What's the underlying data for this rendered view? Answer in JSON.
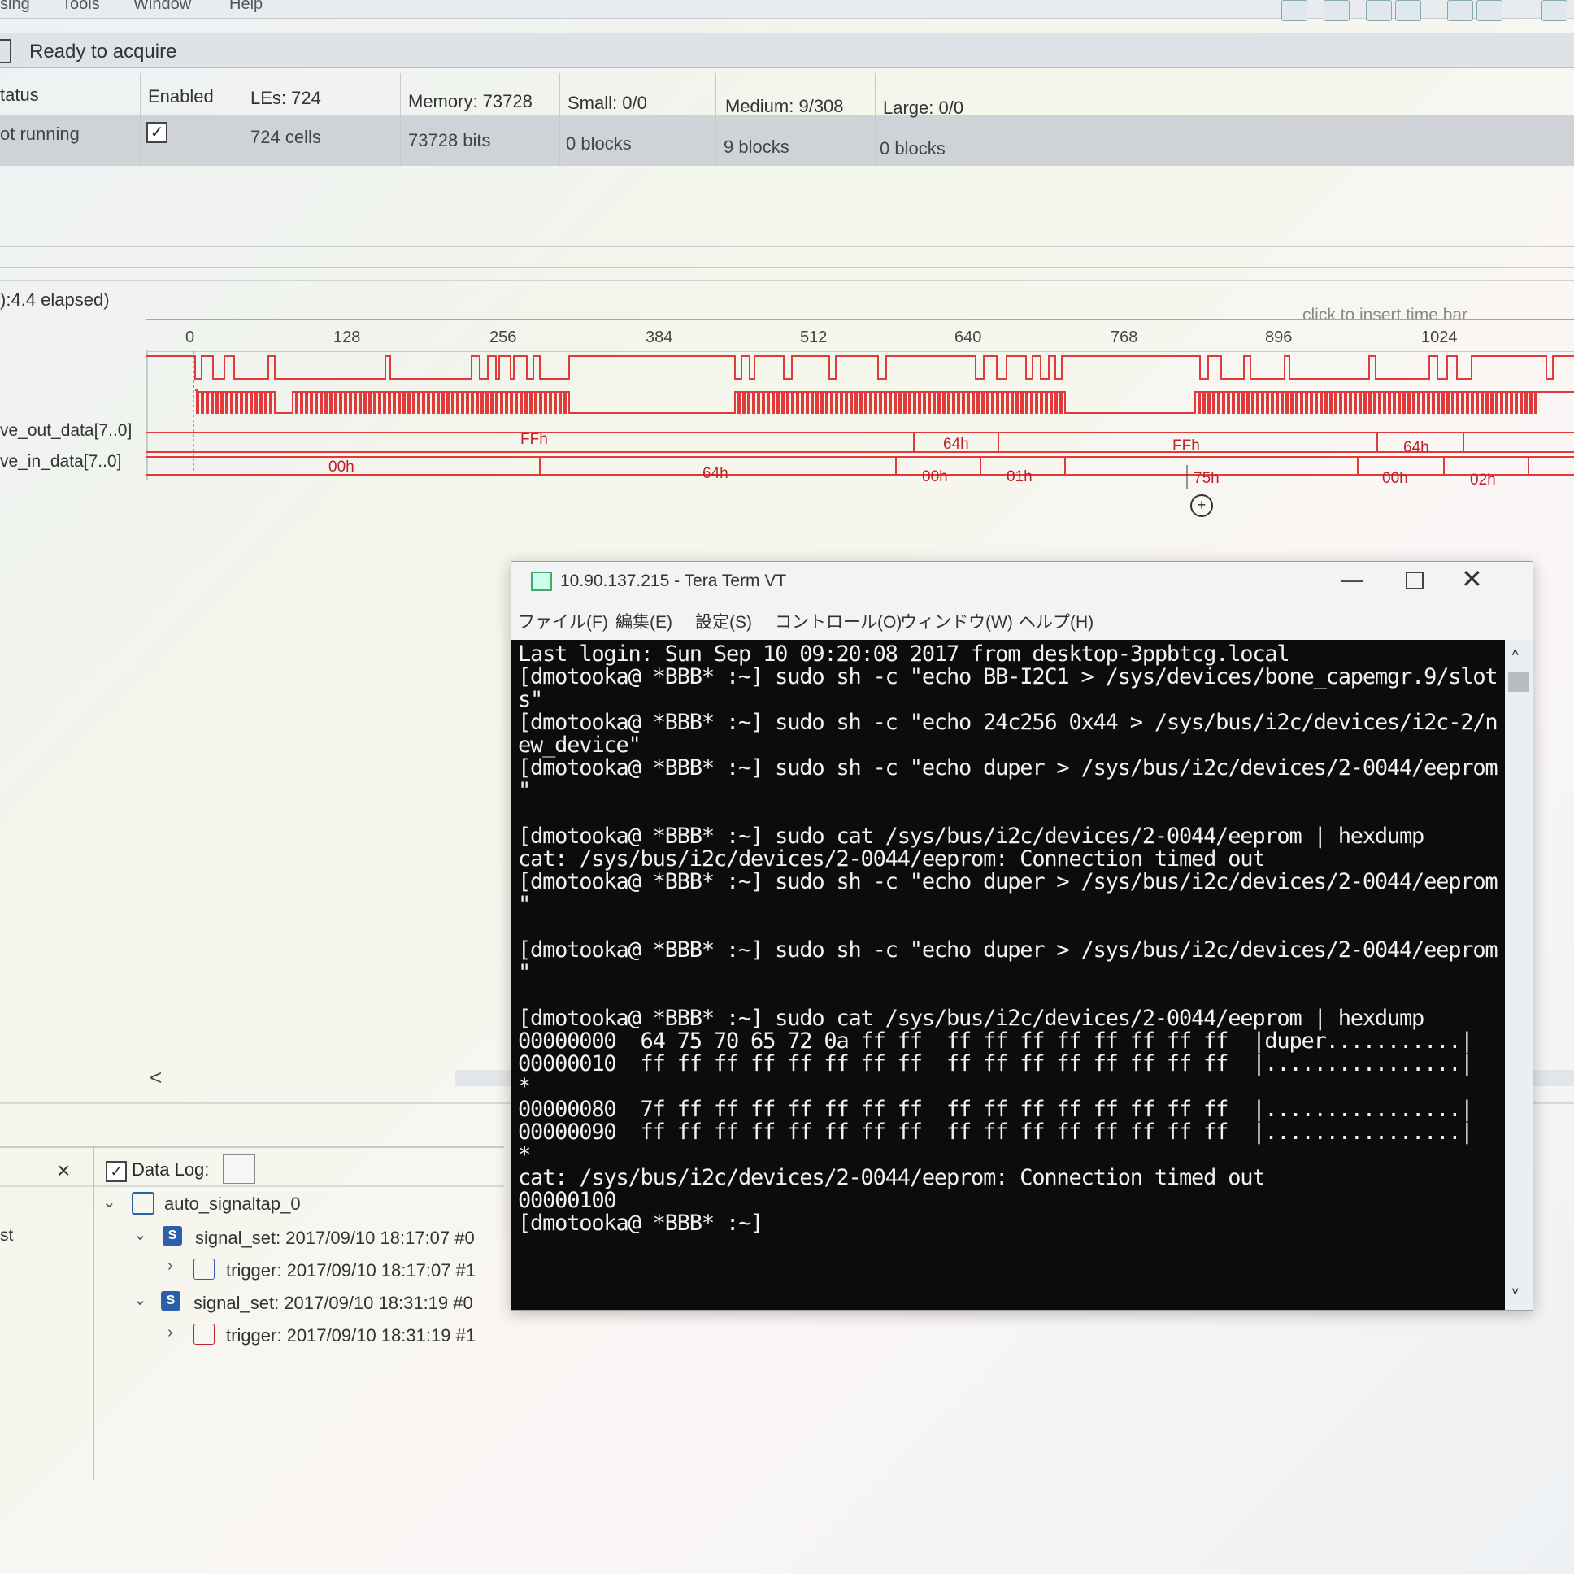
{
  "menu": [
    "sing",
    "Tools",
    "Window",
    "Help"
  ],
  "status": {
    "text": "Ready to acquire"
  },
  "instance_table": {
    "headers": [
      "tatus",
      "Enabled",
      "LEs: 724",
      "Memory: 73728",
      "Small: 0/0",
      "Medium: 9/308",
      "Large: 0/0"
    ],
    "row": [
      "ot running",
      "",
      "724 cells",
      "73728 bits",
      "0 blocks",
      "9 blocks",
      "0 blocks"
    ],
    "enabled_check": "✓"
  },
  "waveform": {
    "elapsed": "):4.4 elapsed)",
    "insert_hint": "click to insert time bar",
    "ticks": [
      "0",
      "128",
      "256",
      "384",
      "512",
      "640",
      "768",
      "896",
      "1024"
    ],
    "signals": [
      "ve_out_data[7..0]",
      "ve_in_data[7..0]"
    ],
    "out_values": [
      "FFh",
      "64h",
      "FFh",
      "64h"
    ],
    "in_values": [
      "00h",
      "64h",
      "00h",
      "01h",
      "75h",
      "00h",
      "02h"
    ]
  },
  "datalog": {
    "close": "×",
    "st": "st",
    "check": "✓",
    "label": "Data Log:",
    "items": [
      {
        "chev": "⌄",
        "icon": "SA",
        "text": "auto_signaltap_0"
      },
      {
        "chev": "⌄",
        "icon": "S",
        "text": "signal_set: 2017/09/10 18:17:07 #0"
      },
      {
        "chev": "›",
        "icon": "T",
        "text": "trigger: 2017/09/10 18:17:07 #1"
      },
      {
        "chev": "⌄",
        "icon": "S",
        "text": "signal_set: 2017/09/10 18:31:19 #0"
      },
      {
        "chev": "›",
        "icon": "T",
        "text": "trigger: 2017/09/10 18:31:19 #1"
      }
    ],
    "scroll_left": "<"
  },
  "teraterm": {
    "title": "10.90.137.215 - Tera Term VT",
    "controls": {
      "min": "—",
      "close": "✕"
    },
    "menu": [
      "ファイル(F)",
      "編集(E)",
      "設定(S)",
      "コントロール(O)",
      "ウィンドウ(W)",
      "ヘルプ(H)"
    ],
    "scroll_up": "˄",
    "scroll_down": "˅",
    "lines": [
      "Last login: Sun Sep 10 09:20:08 2017 from desktop-3ppbtcg.local",
      "[dmotooka@ *BBB* :~] sudo sh -c \"echo BB-I2C1 > /sys/devices/bone_capemgr.9/slot",
      "s\"",
      "[dmotooka@ *BBB* :~] sudo sh -c \"echo 24c256 0x44 > /sys/bus/i2c/devices/i2c-2/n",
      "ew_device\"",
      "[dmotooka@ *BBB* :~] sudo sh -c \"echo duper > /sys/bus/i2c/devices/2-0044/eeprom",
      "\"",
      "",
      "[dmotooka@ *BBB* :~] sudo cat /sys/bus/i2c/devices/2-0044/eeprom | hexdump",
      "cat: /sys/bus/i2c/devices/2-0044/eeprom: Connection timed out",
      "[dmotooka@ *BBB* :~] sudo sh -c \"echo duper > /sys/bus/i2c/devices/2-0044/eeprom",
      "\"",
      "",
      "[dmotooka@ *BBB* :~] sudo sh -c \"echo duper > /sys/bus/i2c/devices/2-0044/eeprom",
      "\"",
      "",
      "[dmotooka@ *BBB* :~] sudo cat /sys/bus/i2c/devices/2-0044/eeprom | hexdump",
      "00000000  64 75 70 65 72 0a ff ff  ff ff ff ff ff ff ff ff  |duper...........|",
      "00000010  ff ff ff ff ff ff ff ff  ff ff ff ff ff ff ff ff  |................|",
      "*",
      "00000080  7f ff ff ff ff ff ff ff  ff ff ff ff ff ff ff ff  |................|",
      "00000090  ff ff ff ff ff ff ff ff  ff ff ff ff ff ff ff ff  |................|",
      "*",
      "cat: /sys/bus/i2c/devices/2-0044/eeprom: Connection timed out",
      "00000100",
      "[dmotooka@ *BBB* :~]"
    ]
  }
}
